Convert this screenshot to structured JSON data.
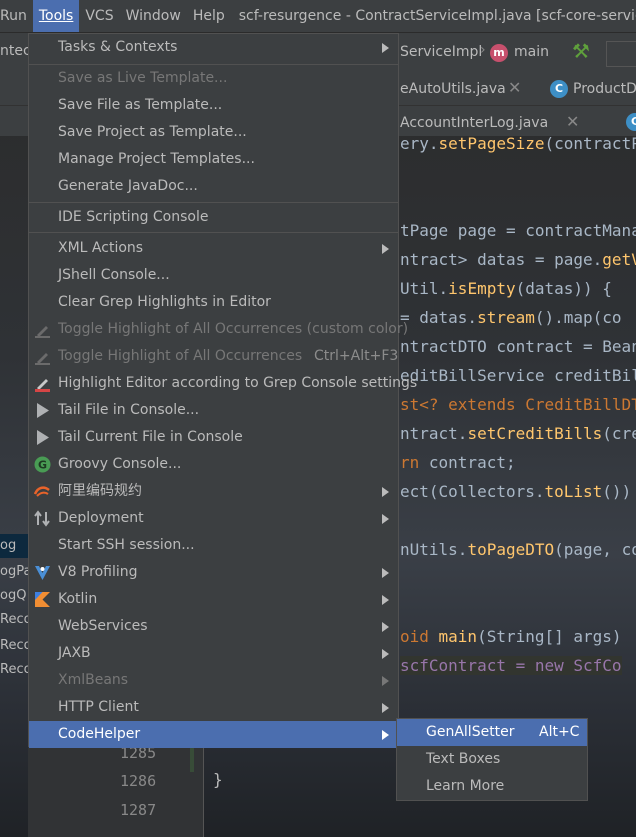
{
  "menubar": {
    "items": [
      {
        "label": "Run"
      },
      {
        "label": "Tools"
      },
      {
        "label": "VCS"
      },
      {
        "label": "Window"
      },
      {
        "label": "Help"
      }
    ],
    "title": "scf-resurgence - ContractServiceImpl.java [scf-core-service]"
  },
  "navbar": {
    "left_fragment": "ntec",
    "crumb_class": "ServiceImpl",
    "crumb_method": "main"
  },
  "tabs": {
    "row1": [
      "eAutoUtils.java",
      "ProductDT"
    ],
    "row2": [
      "AccountInterLog.java"
    ]
  },
  "left_panel": [
    "og",
    "ogPa",
    "ogQ",
    "Reco",
    "Reco",
    "Reco"
  ],
  "code_lines": [
    [
      "",
      "ery.",
      "setPageSize",
      "(contractP"
    ],
    [
      "",
      "tPage page = contractMana",
      "",
      ""
    ],
    [
      "",
      "ntract> datas = page.",
      "getV",
      ""
    ],
    [
      "",
      "Util.",
      "isEmpty",
      "(datas)) {"
    ],
    [
      "",
      " = datas.",
      "stream",
      "().map(co"
    ],
    [
      "",
      "ntractDTO contract = Bean",
      "",
      ""
    ],
    [
      "",
      "editBillService creditBil",
      "",
      ""
    ],
    [
      "",
      "st<? extends CreditBillDT",
      "",
      ""
    ],
    [
      "",
      "ntract.",
      "setCreditBills",
      "(cre"
    ],
    [
      "rn",
      " contract;",
      "",
      ""
    ],
    [
      "",
      "ect(Collectors.",
      "toList",
      "())"
    ],
    [
      "",
      "nUtils.",
      "toPageDTO",
      "(page, co"
    ],
    [
      "oid ",
      "main",
      "",
      "(String[] args)"
    ],
    [
      "",
      "scfContract = new ScfCo",
      "",
      ""
    ]
  ],
  "gutter": [
    "1285",
    "1286",
    "1287"
  ],
  "editor_brace": "}",
  "tools_menu": {
    "items": [
      {
        "label": "Tasks & Contexts",
        "submenu": true
      },
      {
        "label": "Save as Live Template...",
        "disabled": true
      },
      {
        "label": "Save File as Template..."
      },
      {
        "label": "Save Project as Template..."
      },
      {
        "label": "Manage Project Templates..."
      },
      {
        "label": "Generate JavaDoc..."
      },
      {
        "label": "IDE Scripting Console"
      },
      {
        "label": "XML Actions",
        "submenu": true
      },
      {
        "label": "JShell Console..."
      },
      {
        "label": "Clear Grep Highlights in Editor"
      },
      {
        "label": "Toggle Highlight of All Occurrences (custom color)",
        "disabled": true,
        "icon": "highlighter-icon"
      },
      {
        "label": "Toggle Highlight of All Occurrences",
        "shortcut": "Ctrl+Alt+F3",
        "disabled": true,
        "icon": "highlighter-icon"
      },
      {
        "label": "Highlight Editor according to Grep Console settings",
        "icon": "highlighter-red-icon"
      },
      {
        "label": "Tail File in Console...",
        "icon": "play-icon"
      },
      {
        "label": "Tail Current File in Console",
        "icon": "play-icon"
      },
      {
        "label": "Groovy Console...",
        "icon": "groovy-icon"
      },
      {
        "label": "阿里编码规约",
        "submenu": true,
        "icon": "alibaba-icon"
      },
      {
        "label": "Deployment",
        "submenu": true,
        "icon": "deployment-icon"
      },
      {
        "label": "Start SSH session..."
      },
      {
        "label": "V8 Profiling",
        "submenu": true,
        "icon": "v8-icon"
      },
      {
        "label": "Kotlin",
        "submenu": true,
        "icon": "kotlin-icon"
      },
      {
        "label": "WebServices",
        "submenu": true
      },
      {
        "label": "JAXB",
        "submenu": true
      },
      {
        "label": "XmlBeans",
        "submenu": true,
        "disabled": true
      },
      {
        "label": "HTTP Client",
        "submenu": true
      },
      {
        "label": "CodeHelper",
        "submenu": true,
        "highlighted": true
      }
    ]
  },
  "codehelper_submenu": {
    "items": [
      {
        "label": "GenAllSetter",
        "shortcut": "Alt+C",
        "highlighted": true
      },
      {
        "label": "Text Boxes"
      },
      {
        "label": "Learn More"
      }
    ]
  },
  "colors": {
    "selection": "#4b6eaf",
    "menu_bg": "#3c3f41",
    "editor_bg": "#2b2b2b"
  }
}
